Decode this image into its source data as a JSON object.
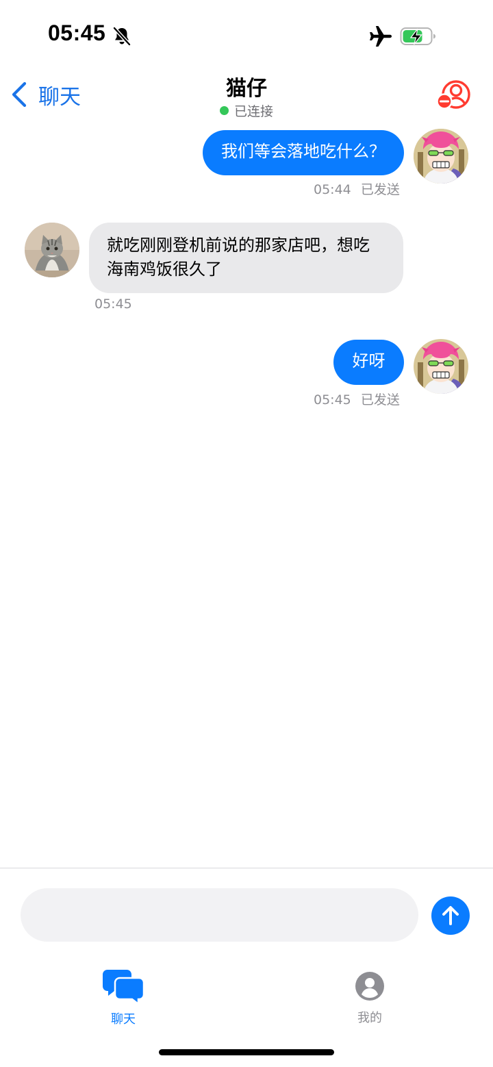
{
  "status_bar": {
    "time": "05:45",
    "icons": [
      "bell-slash-icon",
      "airplane-icon",
      "battery-charging-icon"
    ]
  },
  "nav": {
    "back_label": "聊天",
    "title": "猫仔",
    "connection_status": "已连接",
    "status_color": "#34c759",
    "right_icon": "remove-person-icon"
  },
  "messages": [
    {
      "direction": "outgoing",
      "text": "我们等会落地吃什么？",
      "time": "05:44",
      "status": "已发送"
    },
    {
      "direction": "incoming",
      "lines": [
        "就吃刚刚登机前说的那家店吧，想吃",
        "海南鸡饭很久了"
      ],
      "time": "05:45"
    },
    {
      "direction": "outgoing",
      "text": "好呀",
      "time": "05:45",
      "status": "已发送"
    }
  ],
  "composer": {
    "placeholder": "",
    "send_icon": "arrow-up-icon"
  },
  "tabs": [
    {
      "label": "聊天",
      "icon": "chat-bubbles-icon",
      "active": true
    },
    {
      "label": "我的",
      "icon": "person-circle-icon",
      "active": false
    }
  ],
  "colors": {
    "accent": "#0a7cff",
    "incoming_bubble": "#e9e9eb",
    "danger": "#ff3b30",
    "meta_text": "#8e8e93"
  }
}
